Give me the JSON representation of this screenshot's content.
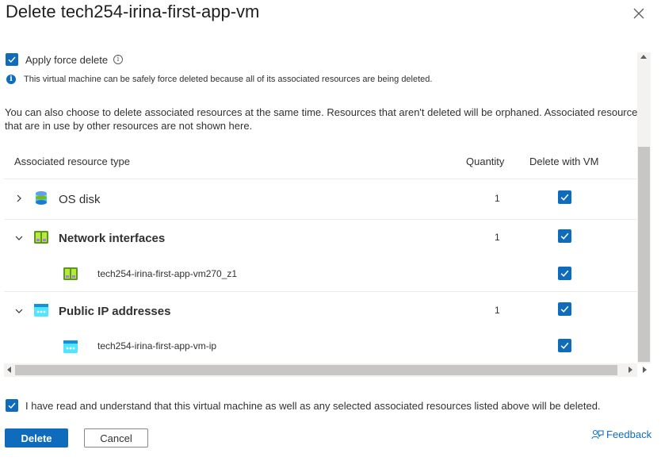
{
  "dialog": {
    "title": "Delete tech254-irina-first-app-vm"
  },
  "force_delete": {
    "label": "Apply force delete",
    "checked": true,
    "info_text": "This virtual machine can be safely force deleted because all of its associated resources are being deleted."
  },
  "description": {
    "line1": "You can also choose to delete associated resources at the same time. Resources that aren't deleted will be orphaned. Associated resources",
    "line2": "that are in use by other resources are not shown here."
  },
  "table": {
    "headers": {
      "type": "Associated resource type",
      "quantity": "Quantity",
      "delete": "Delete with VM"
    },
    "groups": [
      {
        "label": "OS disk",
        "quantity": "1",
        "expanded": false,
        "icon": "disk-icon",
        "checked": true,
        "children": []
      },
      {
        "label": "Network interfaces",
        "quantity": "1",
        "expanded": true,
        "icon": "network-interface-icon",
        "checked": true,
        "children": [
          {
            "label": "tech254-irina-first-app-vm270_z1",
            "icon": "network-interface-icon",
            "checked": true
          }
        ]
      },
      {
        "label": "Public IP addresses",
        "quantity": "1",
        "expanded": true,
        "icon": "public-ip-icon",
        "checked": true,
        "children": [
          {
            "label": "tech254-irina-first-app-vm-ip",
            "icon": "public-ip-icon",
            "checked": true
          }
        ]
      }
    ]
  },
  "confirm": {
    "label": "I have read and understand that this virtual machine as well as any selected associated resources listed above will be deleted.",
    "checked": true
  },
  "footer": {
    "delete_label": "Delete",
    "cancel_label": "Cancel",
    "feedback_label": "Feedback"
  },
  "colors": {
    "accent": "#0f6cbd",
    "text": "#323130"
  }
}
